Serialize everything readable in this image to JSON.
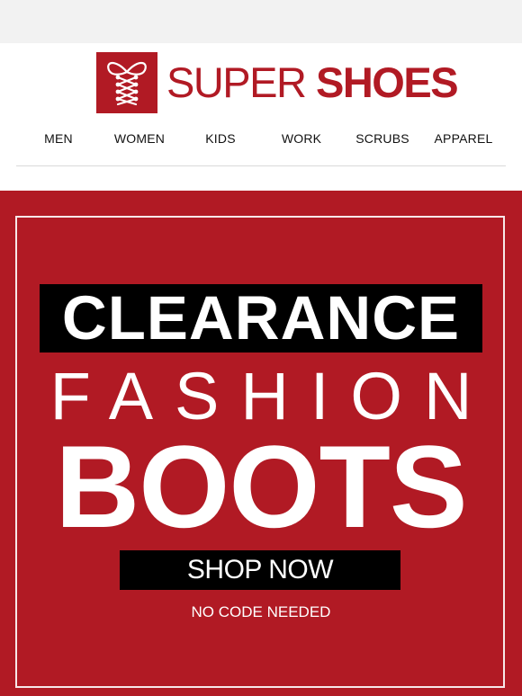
{
  "colors": {
    "brand_red": "#b11a24",
    "black": "#000000",
    "white": "#ffffff",
    "topbar_gray": "#f2f2f2"
  },
  "header": {
    "logo_icon": "shoelace-icon",
    "logo_text_light": "SUPER",
    "logo_text_bold": "SHOES"
  },
  "nav": {
    "items": [
      {
        "label": "MEN"
      },
      {
        "label": "WOMEN"
      },
      {
        "label": "KIDS"
      },
      {
        "label": "WORK"
      },
      {
        "label": "SCRUBS"
      },
      {
        "label": "APPAREL"
      }
    ]
  },
  "hero": {
    "line1": "CLEARANCE",
    "line2": "FASHION",
    "line3": "BOOTS",
    "cta": "SHOP NOW",
    "note": "NO CODE NEEDED"
  }
}
